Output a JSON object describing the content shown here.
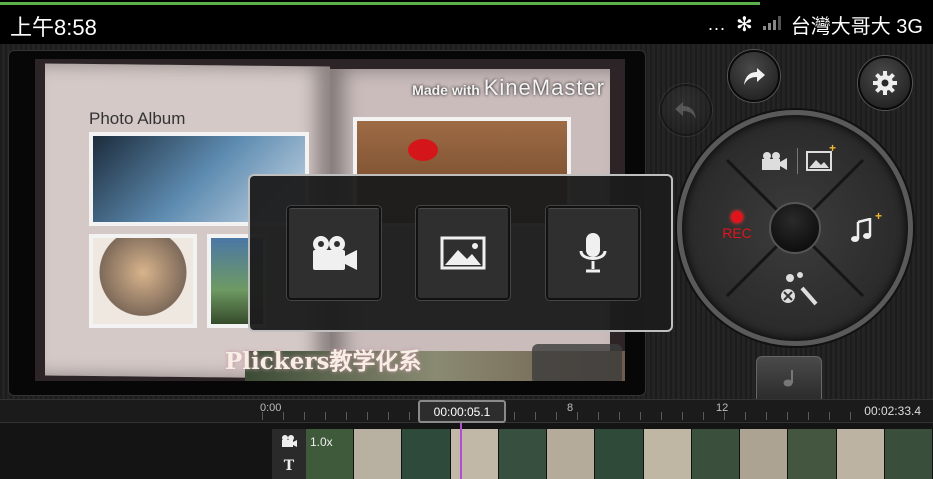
{
  "status_bar": {
    "time": "上午8:58",
    "signal_dots": "...",
    "carrier": "台灣大哥大 3G"
  },
  "preview": {
    "album_title": "Photo Album",
    "watermark_prefix": "Made with",
    "watermark_brand": "KineMaster",
    "caption": "Plickers教学化系"
  },
  "media_popup": {
    "buttons": [
      {
        "icon": "video-camera-icon"
      },
      {
        "icon": "image-icon"
      },
      {
        "icon": "microphone-icon"
      }
    ]
  },
  "controls": {
    "rec_label": "REC",
    "redo_icon": "redo-arrow-icon",
    "undo_icon": "undo-arrow-icon",
    "settings_icon": "gear-icon"
  },
  "timeline": {
    "start_label": "0:00",
    "current_time": "00:00:05.1",
    "mark_8": "8",
    "mark_12": "12",
    "total_time": "00:02:33.4",
    "clip_speed": "1.0x"
  },
  "colors": {
    "accent_red": "#e1141b",
    "plus_orange": "#f2b634",
    "playhead": "#b04fd6",
    "progress_green": "#5db14a"
  }
}
